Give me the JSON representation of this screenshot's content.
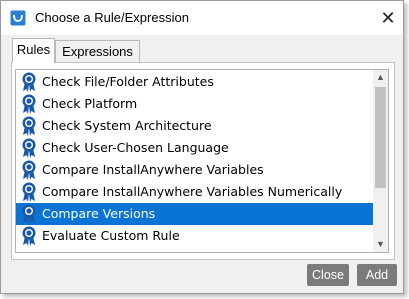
{
  "window": {
    "title": "Choose a Rule/Expression"
  },
  "tabs": [
    {
      "label": "Rules"
    },
    {
      "label": "Expressions"
    }
  ],
  "rules": [
    {
      "label": "Check File/Folder Attributes"
    },
    {
      "label": "Check Platform"
    },
    {
      "label": "Check System Architecture"
    },
    {
      "label": "Check User-Chosen Language"
    },
    {
      "label": "Compare InstallAnywhere Variables"
    },
    {
      "label": "Compare InstallAnywhere Variables Numerically"
    },
    {
      "label": "Compare Versions",
      "selected": true
    },
    {
      "label": "Evaluate Custom Rule"
    }
  ],
  "buttons": {
    "close_label": "Close",
    "add_label": "Add"
  },
  "icons": {
    "rule": "award-ribbon-icon",
    "close": "close-icon",
    "app": "app-icon"
  },
  "colors": {
    "selection": "#0a74d6",
    "ribbon": "#1b58a8",
    "button": "#7b7b7b"
  }
}
